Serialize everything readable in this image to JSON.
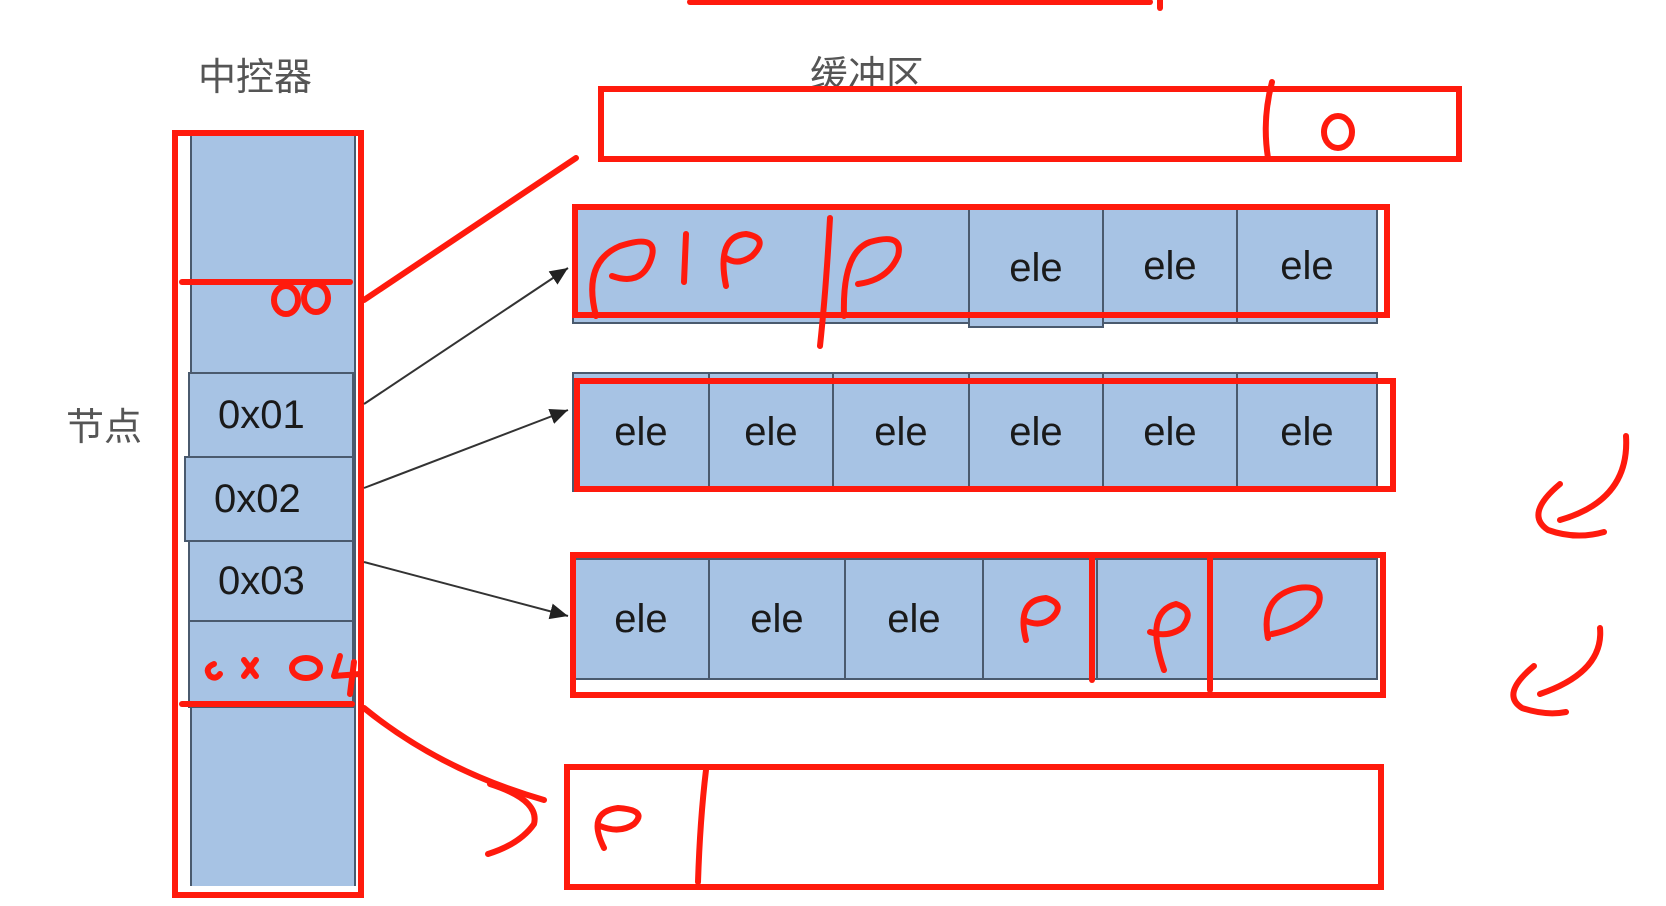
{
  "labels": {
    "controller": "中控器",
    "buffer": "缓冲区",
    "node": "节点"
  },
  "controller_slots": [
    "0x01",
    "0x02",
    "0x03"
  ],
  "buffer_rows": {
    "row1": [
      "ele",
      "ele",
      "ele"
    ],
    "row2": [
      "ele",
      "ele",
      "ele",
      "ele",
      "ele",
      "ele"
    ],
    "row3": [
      "ele",
      "ele",
      "ele"
    ]
  },
  "colors": {
    "cell_fill": "#a7c3e4",
    "cell_border": "#4a5a6e",
    "ink_red": "#ff1a0d"
  }
}
